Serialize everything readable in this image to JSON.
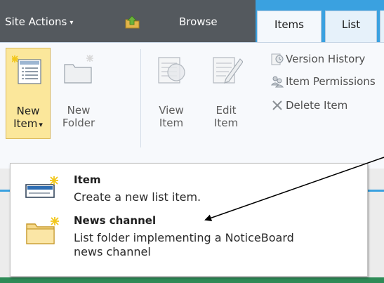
{
  "topbar": {
    "site_actions_label": "Site Actions",
    "site_actions_caret": "▾",
    "browse_label": "Browse"
  },
  "tabs": [
    {
      "label": "Items",
      "selected": true
    },
    {
      "label": "List",
      "selected": false
    }
  ],
  "ribbon": {
    "new_item": {
      "line1": "New",
      "line2": "Item",
      "caret": "▾",
      "active": true
    },
    "new_folder": {
      "line1": "New",
      "line2": "Folder"
    },
    "view_item": {
      "line1": "View",
      "line2": "Item"
    },
    "edit_item": {
      "line1": "Edit",
      "line2": "Item"
    },
    "small_buttons": [
      {
        "label": "Version History",
        "icon": "version-history-icon"
      },
      {
        "label": "Item Permissions",
        "icon": "item-permissions-icon"
      },
      {
        "label": "Delete Item",
        "icon": "delete-icon"
      }
    ]
  },
  "menu": {
    "items": [
      {
        "title": "Item",
        "description": "Create a new list item.",
        "icon": "list-item-icon"
      },
      {
        "title": "News channel",
        "description": "List folder implementing a NoticeBoard news channel",
        "icon": "folder-icon"
      }
    ]
  },
  "colors": {
    "topbar": "#54595e",
    "tab_accent": "#3aa1e0",
    "active_button": "#fbe79b",
    "status_bar": "#2e8b57"
  }
}
